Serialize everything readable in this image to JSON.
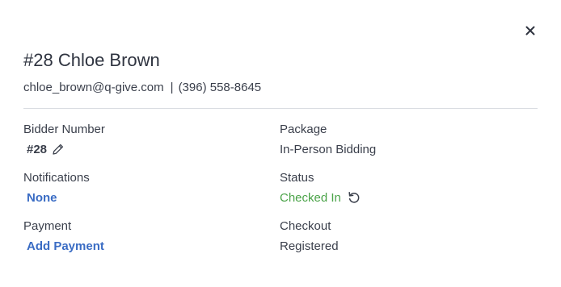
{
  "header": {
    "title": "#28 Chloe Brown",
    "email": "chloe_brown@q-give.com",
    "separator": "|",
    "phone": "(396) 558-8645"
  },
  "fields": {
    "bidder_number": {
      "label": "Bidder Number",
      "value": "#28",
      "icon": "pencil-icon"
    },
    "package": {
      "label": "Package",
      "value": "In-Person Bidding"
    },
    "notifications": {
      "label": "Notifications",
      "value": "None"
    },
    "status": {
      "label": "Status",
      "value": "Checked In",
      "icon": "undo-icon"
    },
    "payment": {
      "label": "Payment",
      "value": "Add Payment"
    },
    "checkout": {
      "label": "Checkout",
      "value": "Registered"
    }
  },
  "icons": {
    "close": "close-icon"
  },
  "colors": {
    "link": "#3a6cc4",
    "status_green": "#4aa348",
    "text": "#3a3f4b",
    "divider": "#d9dce1"
  }
}
